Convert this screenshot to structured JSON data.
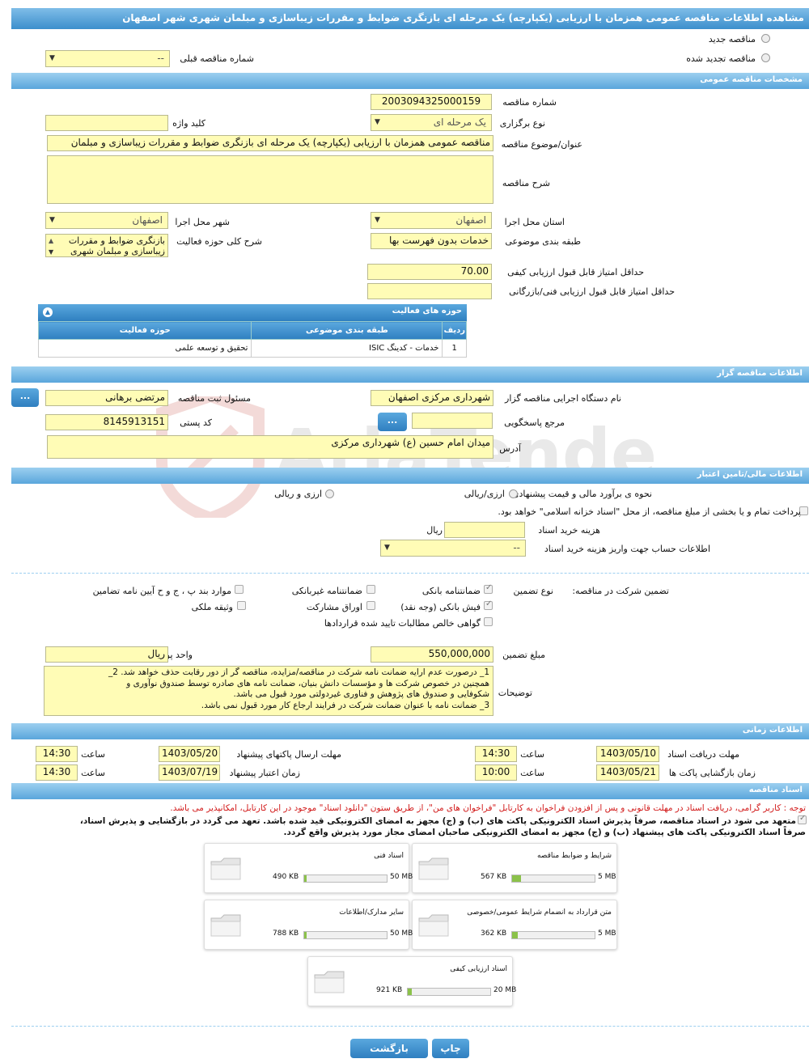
{
  "page_title": "مشاهده اطلاعات مناقصه عمومی همزمان با ارزیابی (یکپارچه) یک مرحله ای بازنگری ضوابط و مقررات زیباسازی و مبلمان شهری شهر اصفهان",
  "top": {
    "new_tender": "مناقصه جدید",
    "renewed_tender": "مناقصه تجدید شده",
    "prev_tender_label": "شماره مناقصه قبلی",
    "prev_tender_value": "--"
  },
  "sections": {
    "general": "مشخصات مناقصه عمومی",
    "organizer": "اطلاعات مناقصه گزار",
    "finance": "اطلاعات مالی/تامین اعتبار",
    "timing": "اطلاعات زمانی",
    "docs": "اسناد مناقصه"
  },
  "general": {
    "tender_no_label": "شماره مناقصه",
    "tender_no": "2003094325000159",
    "type_label": "نوع برگزاری",
    "type_value": "یک مرحله ای",
    "keyword_label": "کلید واژه",
    "keyword_value": "",
    "subject_label": "عنوان/موضوع مناقصه",
    "subject_value": "مناقصه عمومی همزمان با ارزیابی (یکپارچه) یک مرحله ای بازنگری ضوابط و مقررات زیباسازی و مبلمان",
    "desc_label": "شرح مناقصه",
    "desc_value": "",
    "province_label": "استان محل اجرا",
    "province_value": "اصفهان",
    "city_label": "شهر محل اجرا",
    "city_value": "اصفهان",
    "category_label": "طبقه بندی موضوعی",
    "category_value": "خدمات بدون فهرست بها",
    "scope_label": "شرح کلی حوزه فعالیت",
    "scope_value_1": "بازنگری ضوابط و مقررات",
    "scope_value_2": "زیباسازی و مبلمان شهری",
    "min_quality_label": "حداقل امتیاز قابل قبول ارزیابی کیفی",
    "min_quality_value": "70.00",
    "min_tech_label": "حداقل امتیاز قابل قبول ارزیابی فنی/بازرگانی",
    "min_tech_value": ""
  },
  "activity": {
    "title": "حوزه های فعالیت",
    "headers": [
      "ردیف",
      "طبقه بندی موضوعی",
      "حوزه فعالیت"
    ],
    "rows": [
      [
        "1",
        "خدمات - کدینگ ISIC",
        "تحقیق و توسعه علمی"
      ]
    ]
  },
  "organizer": {
    "org_label": "نام دستگاه اجرایی مناقصه گزار",
    "org_value": "شهرداری مرکزی اصفهان",
    "officer_label": "مسئول ثبت مناقصه",
    "officer_value": "مرتضی برهانی",
    "ref_label": "مرجع پاسخگویی",
    "ref_value": "",
    "postal_label": "کد پستی",
    "postal_value": "8145913151",
    "address_label": "آدرس",
    "address_value": "میدان امام حسین (ع) شهرداری مرکزی",
    "more_btn": "..."
  },
  "finance": {
    "estimate_label": "نحوه ی برآورد مالی و قیمت پیشنهادی",
    "opt_rial_fx": "ارزی/ریالی",
    "opt_fx_rial": "ارزی و ریالی",
    "treasury_text": "پرداخت تمام و یا بخشی از مبلغ مناقصه، از محل \"اسناد خزانه اسلامی\" خواهد بود.",
    "doc_cost_label": "هزینه خرید اسناد",
    "doc_cost_value": "",
    "doc_cost_unit": "ریال",
    "account_label": "اطلاعات حساب جهت واریز هزینه خرید اسناد",
    "account_value": "--",
    "guarantee_title": "تضمین شرکت در مناقصه:",
    "guarantee_type_label": "نوع تضمین",
    "g_bank": "ضمانتنامه بانکی",
    "g_nonbank": "ضمانتنامه غیربانکی",
    "g_bylaw": "موارد بند پ ، ج و ح آیین نامه تضامین",
    "g_cheque": "فیش بانکی (وجه نقد)",
    "g_bonds": "اوراق مشارکت",
    "g_property": "وثیقه ملکی",
    "g_claims": "گواهی خالص مطالبات تایید شده قراردادها",
    "amount_label": "مبلغ تضمین",
    "amount_value": "550,000,000",
    "unit_label": "واحد پول",
    "unit_value": "ریال",
    "notes_label": "توضیحات",
    "notes_lines": [
      "1_ درصورت عدم ارایه ضمانت نامه شرکت در مناقصه/مزایده، مناقصه گر از دور رقابت حذف خواهد شد. 2_",
      "همچنین در خصوص شرکت ها و مؤسسات دانش بنیان، ضمانت نامه های صادره توسط صندوق نوآوری و",
      "شکوفایی و صندوق های پژوهش و فناوری غیردولتی مورد قبول می باشد.",
      "3_ ضمانت نامه با عنوان ضمانت شرکت در فرایند ارجاع کار مورد قبول نمی باشد."
    ]
  },
  "timing": {
    "doc_receive_label": "مهلت دریافت اسناد",
    "doc_receive_date": "1403/05/10",
    "doc_receive_time": "14:30",
    "send_label": "مهلت ارسال پاکتهای پیشنهاد",
    "send_date": "1403/05/20",
    "send_time": "14:30",
    "open_label": "زمان بازگشایی پاکت ها",
    "open_date": "1403/05/21",
    "open_time": "10:00",
    "valid_label": "زمان اعتبار پیشنهاد",
    "valid_date": "1403/07/19",
    "valid_time": "14:30",
    "time_label": "ساعت"
  },
  "docs": {
    "notice": "توجه : کاربر گرامی، دریافت اسناد در مهلت قانونی و پس از افزودن فراخوان به کارتابل \"فراخوان های من\"، از طریق ستون \"دانلود اسناد\" موجود در این کارتابل، امکانپذیر می باشد.",
    "commit_1": "متعهد می شود در اسناد مناقصه، صرفاً پذیرش اسناد الکترونیکی پاکت های (ب) و (ج) مجهز به امضای الکترونیکی قید شده باشد. تعهد می گردد در بازگشایی و پذیرش اسناد،",
    "commit_2": "صرفاً اسناد الکترونیکی پاکت های پیشنهاد (ب) و (ج) مجهز به امضای الکترونیکی صاحبان امضای مجاز مورد پذیرش واقع گردد.",
    "files": [
      {
        "name": "شرایط و ضوابط مناقصه",
        "size": "567 KB",
        "max": "5 MB",
        "pct": 0.11
      },
      {
        "name": "اسناد فنی",
        "size": "490 KB",
        "max": "50 MB",
        "pct": 0.01
      },
      {
        "name": "متن قرارداد به انضمام شرایط عمومی/خصوصی",
        "size": "362 KB",
        "max": "5 MB",
        "pct": 0.07
      },
      {
        "name": "سایر مدارک/اطلاعات",
        "size": "788 KB",
        "max": "50 MB",
        "pct": 0.016
      },
      {
        "name": "اسناد ارزیابی کیفی",
        "size": "921 KB",
        "max": "20 MB",
        "pct": 0.045
      }
    ]
  },
  "buttons": {
    "print": "چاپ",
    "back": "بازگشت"
  },
  "colors": {
    "accent": "#3c8fcc",
    "field": "#fffcb6",
    "notice": "#d21a1a"
  }
}
